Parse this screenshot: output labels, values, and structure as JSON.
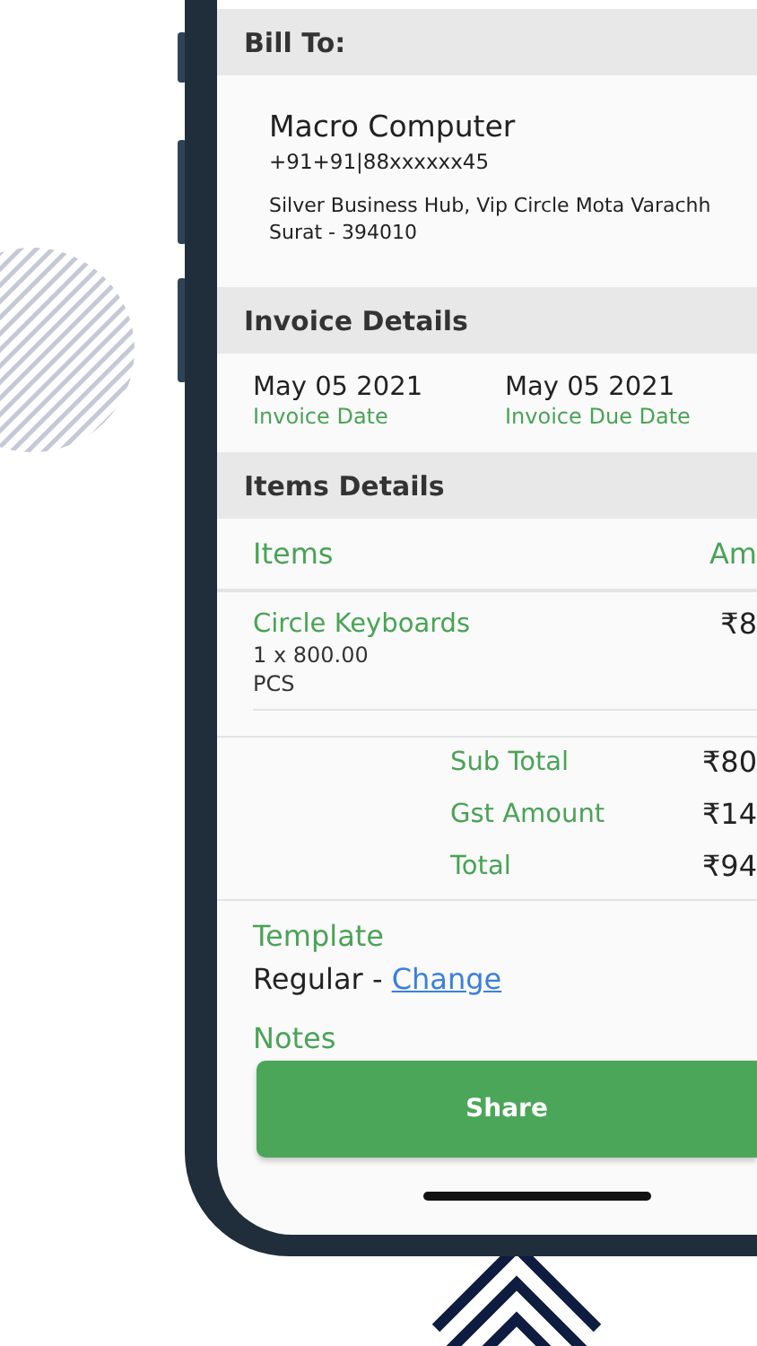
{
  "bill_to": {
    "title": "Bill To:",
    "name": "Macro Computer",
    "phone": "+91+91|88xxxxxx45",
    "address": [
      "Silver Business Hub, Vip Circle Mota Varachh",
      "Surat - 394010"
    ]
  },
  "invoice_details": {
    "title": "Invoice Details",
    "dates": [
      {
        "value": "May 05 2021",
        "label": "Invoice Date"
      },
      {
        "value": "May 05 2021",
        "label": "Invoice Due Date"
      }
    ]
  },
  "items_details": {
    "title": "Items Details",
    "columns": [
      "Items",
      "Am"
    ],
    "items": [
      {
        "name": "Circle Keyboards",
        "quantity": "1 x 800.00",
        "unit": "PCS",
        "amount": "₹8"
      }
    ],
    "totals": [
      {
        "label": "Sub Total",
        "value": "₹80"
      },
      {
        "label": "Gst Amount",
        "value": "₹14"
      },
      {
        "label": "Total",
        "value": "₹94"
      }
    ]
  },
  "template": {
    "label": "Template",
    "value": "Regular -",
    "link": "Change"
  },
  "notes": {
    "label": "Notes"
  },
  "share_button": "Share"
}
